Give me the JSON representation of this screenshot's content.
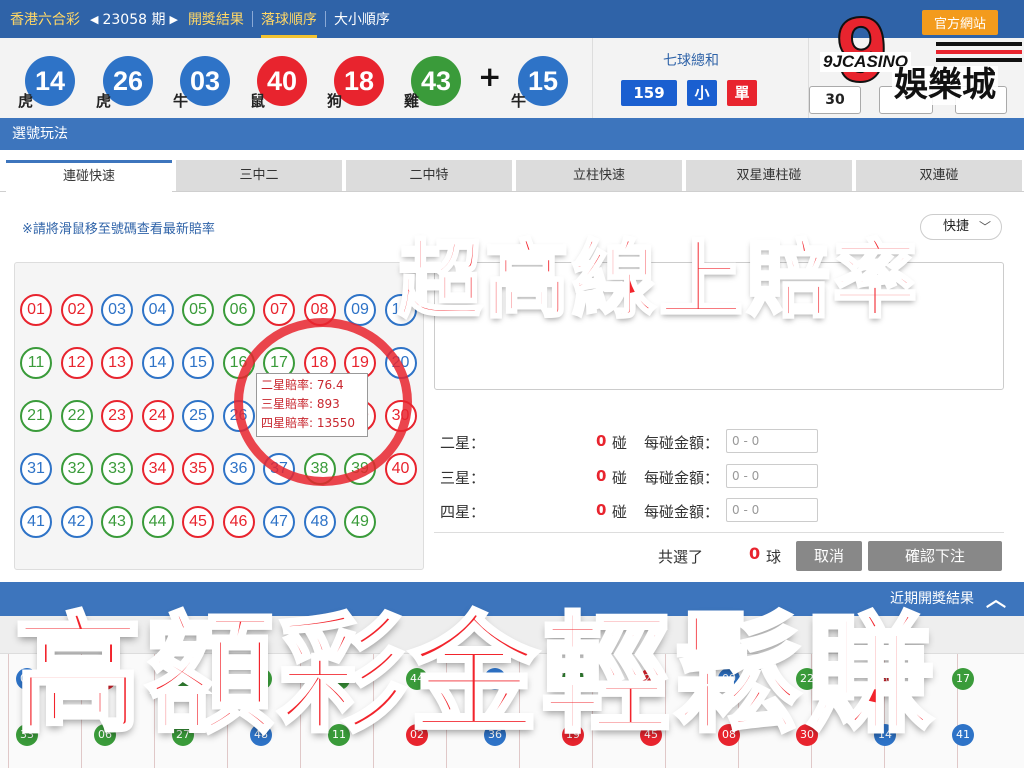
{
  "topbar": {
    "game_name": "香港六合彩",
    "prev_arrow": "◀",
    "period": "23058 期",
    "next_arrow": "▶",
    "nav": [
      "開獎結果",
      "落球順序",
      "大小順序"
    ],
    "official_site": "官方網站"
  },
  "result": {
    "balls": [
      {
        "num": "14",
        "zodiac": "虎",
        "color": "blue"
      },
      {
        "num": "26",
        "zodiac": "虎",
        "color": "blue"
      },
      {
        "num": "03",
        "zodiac": "牛",
        "color": "blue"
      },
      {
        "num": "40",
        "zodiac": "鼠",
        "color": "red"
      },
      {
        "num": "18",
        "zodiac": "狗",
        "color": "red"
      },
      {
        "num": "43",
        "zodiac": "雞",
        "color": "green"
      }
    ],
    "plus": "+",
    "special": {
      "num": "15",
      "zodiac": "牛",
      "color": "blue"
    },
    "sum_title": "七球總和",
    "sum_value": "159",
    "sum_size": "小",
    "sum_parity": "單",
    "right_value": "30"
  },
  "logo": {
    "brand": "9JCASINO",
    "name": "娛樂城",
    "nine": "9"
  },
  "section_title": "選號玩法",
  "tabs": [
    "連碰快速",
    "三中二",
    "二中特",
    "立柱快速",
    "双星連柱碰",
    "双連碰"
  ],
  "notice": "※請將滑鼠移至號碼查看最新賠率",
  "quick_select": {
    "label": "快捷",
    "chevron": "﹀"
  },
  "numbers": [
    "01",
    "02",
    "03",
    "04",
    "05",
    "06",
    "07",
    "08",
    "09",
    "10",
    "11",
    "12",
    "13",
    "14",
    "15",
    "16",
    "17",
    "18",
    "19",
    "20",
    "21",
    "22",
    "23",
    "24",
    "25",
    "26",
    "27",
    "28",
    "29",
    "30",
    "31",
    "32",
    "33",
    "34",
    "35",
    "36",
    "37",
    "38",
    "39",
    "40",
    "41",
    "42",
    "43",
    "44",
    "45",
    "46",
    "47",
    "48",
    "49"
  ],
  "colors": {
    "red": "#e8242e",
    "blue": "#2e73c7",
    "green": "#3a9b3a",
    "header_blue": "#2f63a8",
    "accent_orange": "#f39b1c"
  },
  "tooltip": {
    "line1": "二星賠率: 76.4",
    "line2": "三星賠率: 893",
    "line3": "四星賠率: 13550"
  },
  "form": {
    "rows": [
      {
        "label": "二星：",
        "count": "0",
        "unit": "碰",
        "per": "每碰金額：",
        "placeholder": "0 - 0"
      },
      {
        "label": "三星：",
        "count": "0",
        "unit": "碰",
        "per": "每碰金額：",
        "placeholder": "0 - 0"
      },
      {
        "label": "四星：",
        "count": "0",
        "unit": "碰",
        "per": "每碰金額：",
        "placeholder": "0 - 0"
      }
    ],
    "selected_label": "共選了",
    "selected_count": "0",
    "selected_unit": "球",
    "cancel": "取消",
    "confirm": "確認下注"
  },
  "recent_results": {
    "label": "近期開獎結果",
    "toggle": "︿"
  },
  "overlay": {
    "top_text": "超高線上賠率",
    "bottom_text": "高額彩金輕鬆賺"
  }
}
